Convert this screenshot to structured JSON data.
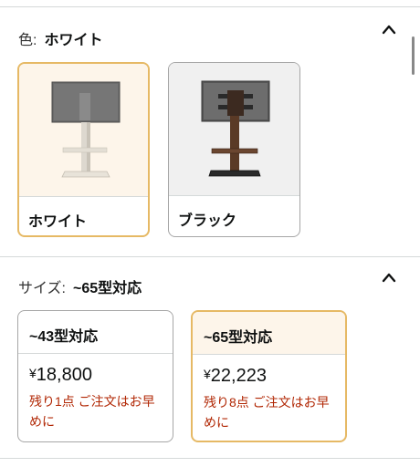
{
  "color_section": {
    "label": "色:",
    "selected_value": "ホワイト",
    "toggle_icon": "chevron-up-icon",
    "options": [
      {
        "name": "ホワイト",
        "selected": true
      },
      {
        "name": "ブラック",
        "selected": false
      }
    ]
  },
  "size_section": {
    "label": "サイズ:",
    "selected_value": "~65型対応",
    "toggle_icon": "chevron-up-icon",
    "options": [
      {
        "title": "~43型対応",
        "currency": "¥",
        "price": "18,800",
        "stock_note": "残り1点 ご注文はお早めに",
        "selected": false
      },
      {
        "title": "~65型対応",
        "currency": "¥",
        "price": "22,223",
        "stock_note": "残り8点 ご注文はお早めに",
        "selected": true
      }
    ]
  },
  "colors": {
    "selected_border": "#e6b965",
    "selected_bg": "#fdf5ea",
    "stock_text": "#b12704",
    "border": "#a6a6a6"
  }
}
